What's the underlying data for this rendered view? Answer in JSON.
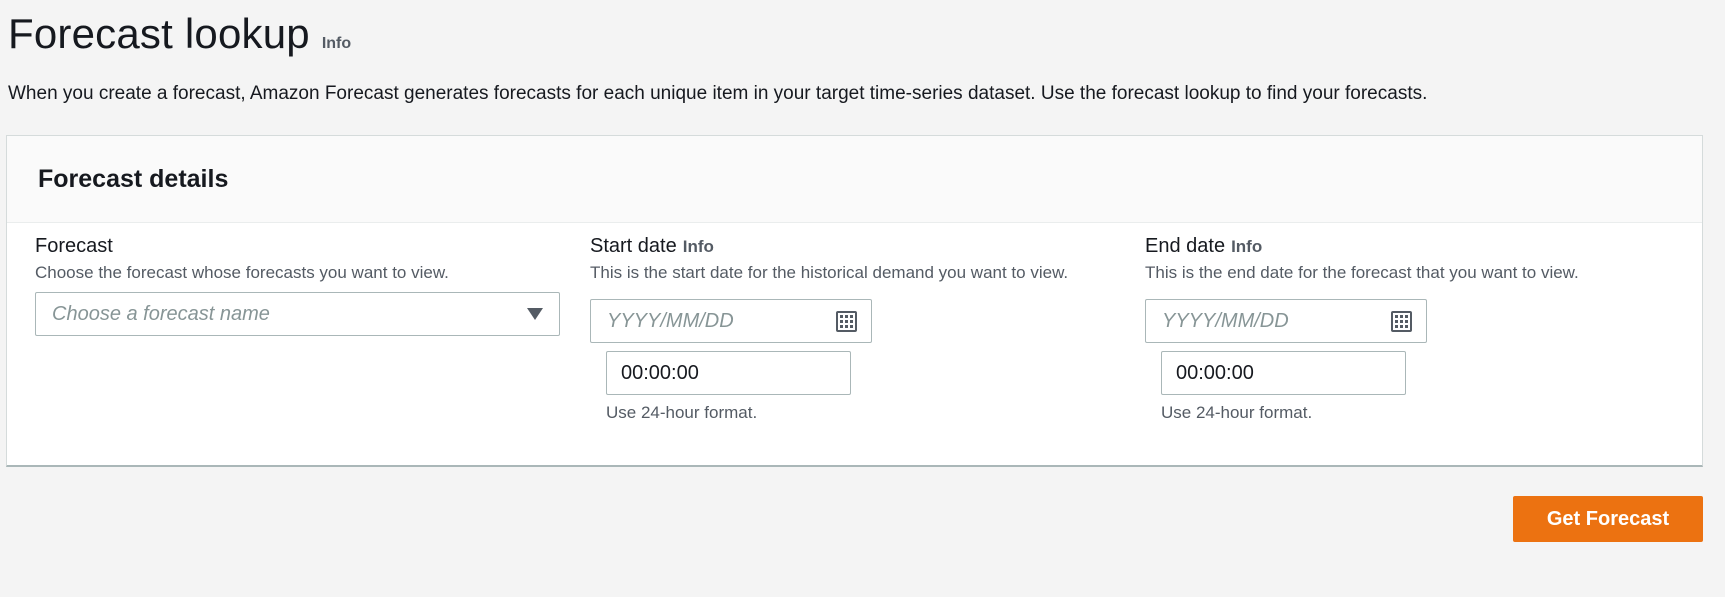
{
  "header": {
    "title": "Forecast lookup",
    "info_label": "Info",
    "description": "When you create a forecast, Amazon Forecast generates forecasts for each unique item in your target time-series dataset. Use the forecast lookup to find your forecasts."
  },
  "panel": {
    "title": "Forecast details",
    "forecast": {
      "label": "Forecast",
      "description": "Choose the forecast whose forecasts you want to view.",
      "placeholder": "Choose a forecast name",
      "icon": "caret-down-icon"
    },
    "start_date": {
      "label": "Start date",
      "info_label": "Info",
      "description": "This is the start date for the historical demand you want to view.",
      "date_placeholder": "YYYY/MM/DD",
      "date_value": "",
      "time_value": "00:00:00",
      "time_hint": "Use 24-hour format.",
      "icon": "calendar-icon"
    },
    "end_date": {
      "label": "End date",
      "info_label": "Info",
      "description": "This is the end date for the forecast that you want to view.",
      "date_placeholder": "YYYY/MM/DD",
      "date_value": "",
      "time_value": "00:00:00",
      "time_hint": "Use 24-hour format.",
      "icon": "calendar-icon"
    }
  },
  "actions": {
    "get_forecast_label": "Get Forecast"
  },
  "colors": {
    "primary_button": "#ec7211",
    "page_background": "#f4f4f4",
    "text": "#16191f",
    "secondary_text": "#545b64",
    "placeholder": "#879596",
    "border": "#aab7b8"
  }
}
